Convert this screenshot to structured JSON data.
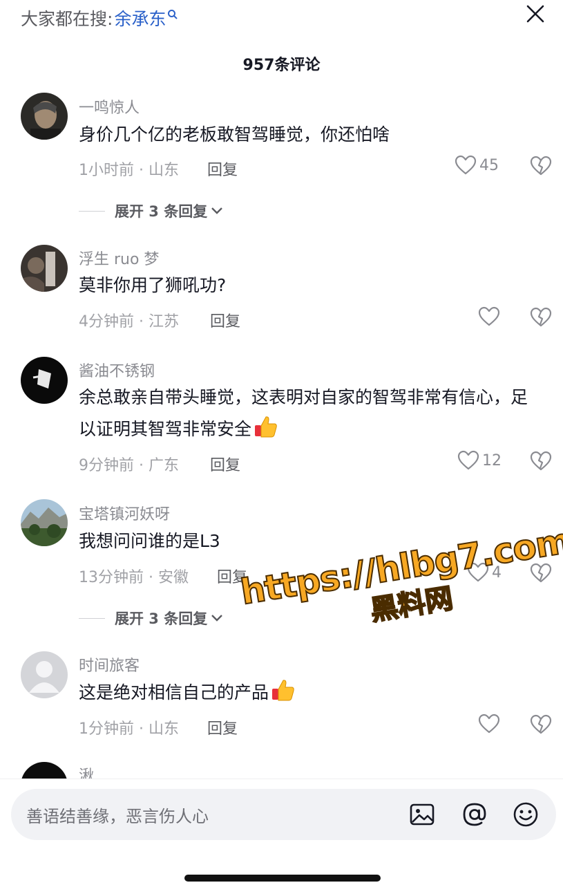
{
  "header": {
    "search_prefix": "大家都在搜:",
    "search_term": "余承东",
    "comment_count": "957条评论"
  },
  "comments": [
    {
      "user": "一鸣惊人",
      "text": "身价几个亿的老板敢智驾睡觉，你还怕啥",
      "time_loc": "1小时前 · 山东",
      "reply": "回复",
      "likes": "45"
    },
    {
      "user": "浮生 ruo 梦",
      "text": "莫非你用了狮吼功?",
      "time_loc": "4分钟前 · 江苏",
      "reply": "回复",
      "likes": ""
    },
    {
      "user": "酱油不锈钢",
      "text": "余总敢亲自带头睡觉，这表明对自家的智驾非常有信心，足以证明其智驾非常安全",
      "time_loc": "9分钟前 · 广东",
      "reply": "回复",
      "likes": "12"
    },
    {
      "user": "宝塔镇河妖呀",
      "text": "我想问问谁的是L3",
      "time_loc": "13分钟前 · 安徽",
      "reply": "回复",
      "likes": "4"
    },
    {
      "user": "时间旅客",
      "text": "这是绝对相信自己的产品",
      "time_loc": "1分钟前 · 山东",
      "reply": "回复",
      "likes": ""
    },
    {
      "user": "湫"
    }
  ],
  "expand_label": "展开 3 条回复",
  "watermark": {
    "url": "https://hlbg7.com",
    "name": "黑料网"
  },
  "input": {
    "placeholder": "善语结善缘，恶言伤人心"
  },
  "icons": {
    "search": "search-icon",
    "close": "close-icon",
    "like": "heart-icon",
    "dislike": "broken-heart-icon",
    "image": "image-icon",
    "mention": "at-icon",
    "emoji": "smiley-icon"
  }
}
